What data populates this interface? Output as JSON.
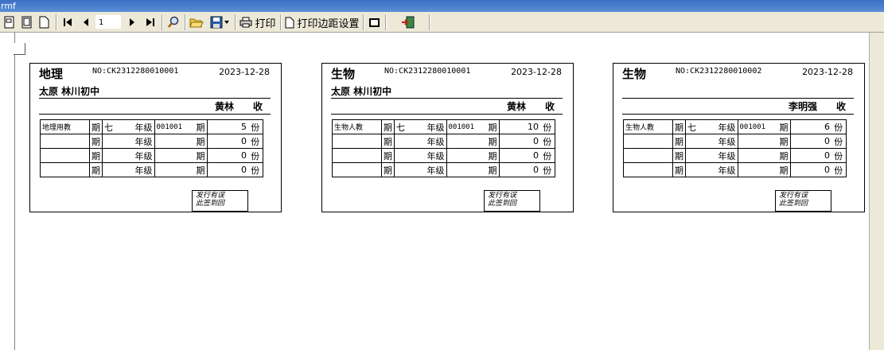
{
  "window": {
    "title": "rmf"
  },
  "toolbar": {
    "buttons": [
      {
        "name": "page-single-button",
        "icon": "page-icon"
      },
      {
        "name": "page-two-button",
        "icon": "page-icon"
      },
      {
        "name": "page-width-button",
        "icon": "page-icon"
      },
      {
        "name": "first-page-button",
        "icon": "first-page-icon"
      },
      {
        "name": "prev-page-button",
        "icon": "prev-icon"
      },
      {
        "name": "next-page-button",
        "icon": "next-icon"
      },
      {
        "name": "last-page-button",
        "icon": "last-page-icon"
      },
      {
        "name": "find-button",
        "icon": "search-icon"
      },
      {
        "name": "open-button",
        "icon": "folder-icon"
      },
      {
        "name": "save-button",
        "icon": "save-icon"
      }
    ],
    "page_number": "1",
    "print_label": "打印",
    "print_margin_label": "打印边距设置"
  },
  "cards": [
    {
      "subject": "地理",
      "no": "NO:CK2312280010001",
      "date": "2023-12-28",
      "school": "太原  林川初中",
      "recipient": "黄林",
      "receive_label": "收",
      "rows": [
        {
          "c1": "地理用教",
          "c2": "期",
          "c3": "七",
          "c4": "年级",
          "c5": "001001",
          "c6": "期",
          "c7": "5",
          "c8": "份"
        },
        {
          "c1": "",
          "c2": "期",
          "c3": "",
          "c4": "年级",
          "c5": "",
          "c6": "期",
          "c7": "0",
          "c8": "份"
        },
        {
          "c1": "",
          "c2": "期",
          "c3": "",
          "c4": "年级",
          "c5": "",
          "c6": "期",
          "c7": "0",
          "c8": "份"
        },
        {
          "c1": "",
          "c2": "期",
          "c3": "",
          "c4": "年级",
          "c5": "",
          "c6": "期",
          "c7": "0",
          "c8": "份"
        }
      ],
      "stamp_line1": "发行有误",
      "stamp_line2": "此签到回"
    },
    {
      "subject": "生物",
      "no": "NO:CK2312280010001",
      "date": "2023-12-28",
      "school": "太原  林川初中",
      "recipient": "黄林",
      "receive_label": "收",
      "rows": [
        {
          "c1": "生物人教",
          "c2": "期",
          "c3": "七",
          "c4": "年级",
          "c5": "001001",
          "c6": "期",
          "c7": "10",
          "c8": "份"
        },
        {
          "c1": "",
          "c2": "期",
          "c3": "",
          "c4": "年级",
          "c5": "",
          "c6": "期",
          "c7": "0",
          "c8": "份"
        },
        {
          "c1": "",
          "c2": "期",
          "c3": "",
          "c4": "年级",
          "c5": "",
          "c6": "期",
          "c7": "0",
          "c8": "份"
        },
        {
          "c1": "",
          "c2": "期",
          "c3": "",
          "c4": "年级",
          "c5": "",
          "c6": "期",
          "c7": "0",
          "c8": "份"
        }
      ],
      "stamp_line1": "发行有误",
      "stamp_line2": "此签到回"
    },
    {
      "subject": "生物",
      "no": "NO:CK2312280010002",
      "date": "2023-12-28",
      "school": "",
      "recipient": "李明强",
      "receive_label": "收",
      "rows": [
        {
          "c1": "生物人教",
          "c2": "期",
          "c3": "七",
          "c4": "年级",
          "c5": "001001",
          "c6": "期",
          "c7": "6",
          "c8": "份"
        },
        {
          "c1": "",
          "c2": "期",
          "c3": "",
          "c4": "年级",
          "c5": "",
          "c6": "期",
          "c7": "0",
          "c8": "份"
        },
        {
          "c1": "",
          "c2": "期",
          "c3": "",
          "c4": "年级",
          "c5": "",
          "c6": "期",
          "c7": "0",
          "c8": "份"
        },
        {
          "c1": "",
          "c2": "期",
          "c3": "",
          "c4": "年级",
          "c5": "",
          "c6": "期",
          "c7": "0",
          "c8": "份"
        }
      ],
      "stamp_line1": "发行有误",
      "stamp_line2": "此签到回"
    }
  ]
}
